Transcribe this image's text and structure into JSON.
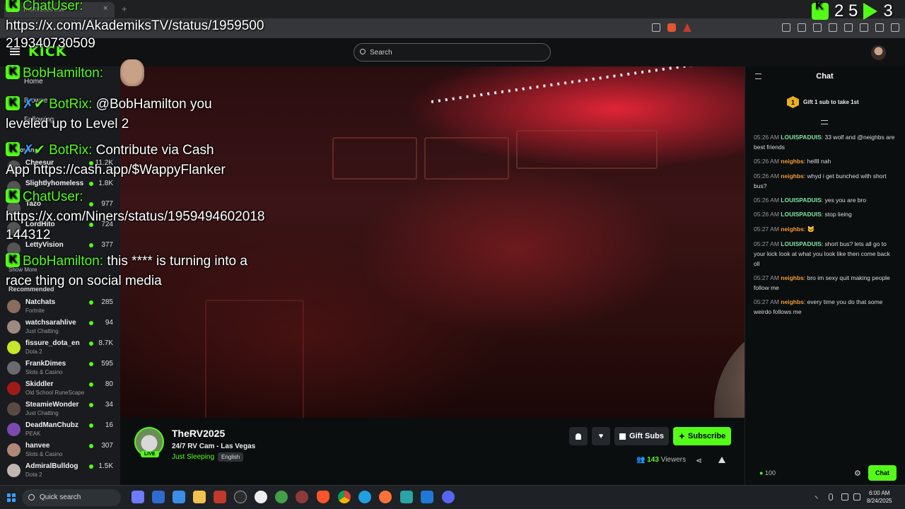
{
  "browser": {
    "tab_title": "TheRV2025 Live",
    "new_tab": "+",
    "close": "×"
  },
  "header": {
    "logo": "KICK",
    "search_placeholder": "Search"
  },
  "sidebar": {
    "nav": [
      {
        "label": "Home",
        "icon": "home-icon"
      },
      {
        "label": "Browse",
        "icon": "browse-icon"
      },
      {
        "label": "Following",
        "icon": "heart-icon"
      }
    ],
    "following_section": "Following",
    "following": [
      {
        "name": "Cheesur",
        "viewers": "11.2K"
      },
      {
        "name": "Slightlyhomeless",
        "viewers": "1.8K"
      },
      {
        "name": "Tazo",
        "viewers": "977"
      },
      {
        "name": "LordHito",
        "viewers": "724"
      },
      {
        "name": "LettyVision",
        "viewers": "377"
      }
    ],
    "show_more": "Show More",
    "recommended_section": "Recommended",
    "recommended": [
      {
        "name": "Natchats",
        "category": "Fortnite",
        "viewers": "285"
      },
      {
        "name": "watchsarahlive",
        "category": "Just Chatting",
        "viewers": "94"
      },
      {
        "name": "fissure_dota_en",
        "category": "Dota 2",
        "viewers": "8.7K"
      },
      {
        "name": "FrankDimes",
        "category": "Slots & Casino",
        "viewers": "595"
      },
      {
        "name": "Skiddler",
        "category": "Old School RuneScape",
        "viewers": "80"
      },
      {
        "name": "SteamieWonder",
        "category": "Just Chatting",
        "viewers": "34"
      },
      {
        "name": "DeadManChubz",
        "category": "PEAK",
        "viewers": "16"
      },
      {
        "name": "hanvee",
        "category": "Slots & Casino",
        "viewers": "307"
      },
      {
        "name": "AdmiralBulldog",
        "category": "Dota 2",
        "viewers": "1.5K"
      }
    ]
  },
  "stream": {
    "streamer": "TheRV2025",
    "live_label": "LIVE",
    "title": "24/7 RV Cam - Las Vegas",
    "category": "Just Sleeping",
    "language": "English",
    "gift_subs_label": "Gift Subs",
    "subscribe_label": "Subscribe",
    "viewer_count": "143",
    "viewers_label": "Viewers"
  },
  "chat": {
    "title": "Chat",
    "gift_pin_count": "1",
    "gift_pin_text": "Gift 1 sub to take 1st",
    "messages": [
      {
        "time": "05:26 AM",
        "user": "LOUISPADUIS",
        "text": ": 33 wolf and @neighbs are best friends",
        "color": "u1"
      },
      {
        "time": "05:26 AM",
        "user": "neighbs",
        "text": ": hellll nah",
        "color": "u2"
      },
      {
        "time": "05:26 AM",
        "user": "neighbs",
        "text": ": whyd i get bunched with short bus?",
        "color": "u2"
      },
      {
        "time": "05:26 AM",
        "user": "LOUISPADUIS",
        "text": ": yes you are bro",
        "color": "u1"
      },
      {
        "time": "05:26 AM",
        "user": "LOUISPADUIS",
        "text": ": stop lieing",
        "color": "u1"
      },
      {
        "time": "05:27 AM",
        "user": "neighbs",
        "text": ": 🐱",
        "color": "u2"
      },
      {
        "time": "05:27 AM",
        "user": "LOUISPADUIS",
        "text": ": short bus? lets all go to your kick look at what you look like then come back oll",
        "color": "u1"
      },
      {
        "time": "05:27 AM",
        "user": "neighbs",
        "text": ": bro im sexy quit making people follow me",
        "color": "u2"
      },
      {
        "time": "05:27 AM",
        "user": "neighbs",
        "text": ": every time you do that some weirdo follows me",
        "color": "u2"
      }
    ],
    "points": "100",
    "chat_button": "Chat"
  },
  "overlay": {
    "counter_a": "2 5",
    "counter_b": "3",
    "lines": [
      {
        "user": "ChatUser:",
        "text": ""
      },
      {
        "user": "",
        "text": "https://x.com/AkademiksTV/status/1959500"
      },
      {
        "user": "",
        "text": "219340730509"
      },
      {
        "user": "BobHamilton:",
        "text": ""
      },
      {
        "user": "BotRix:",
        "text": " @BobHamilton you"
      },
      {
        "user": "",
        "text": "leveled up to Level 2"
      },
      {
        "user": "BotRix:",
        "text": " Contribute via Cash"
      },
      {
        "user": "",
        "text": "App https://cash.app/$WappyFlanker"
      },
      {
        "user": "ChatUser:",
        "text": ""
      },
      {
        "user": "",
        "text": "https://x.com/Niners/status/1959494602018"
      },
      {
        "user": "",
        "text": "144312"
      },
      {
        "user": "BobHamilton:",
        "text": " this **** is turning into a"
      },
      {
        "user": "",
        "text": "race thing on social media"
      }
    ]
  },
  "taskbar": {
    "search_label": "Quick search",
    "time": "6:00 AM",
    "date": "8/24/2025"
  }
}
